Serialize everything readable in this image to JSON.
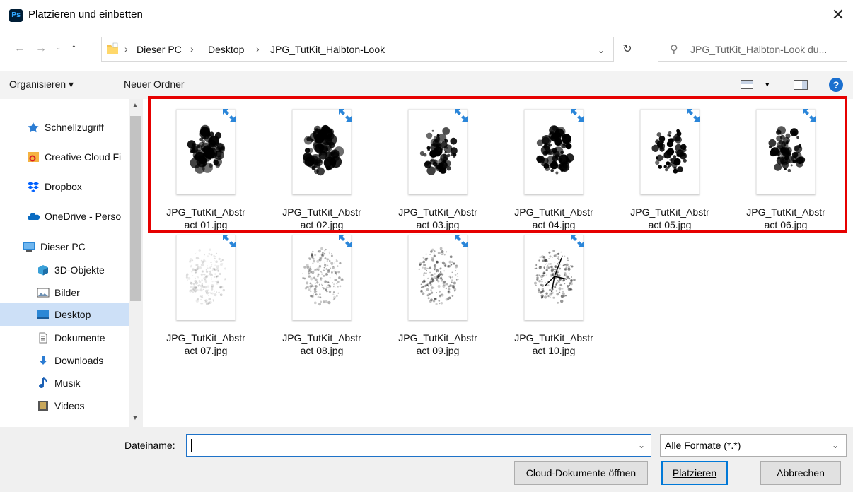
{
  "window": {
    "app_icon": "Ps",
    "title": "Platzieren und einbetten",
    "close_glyph": "✕"
  },
  "address": {
    "breadcrumbs": [
      "Dieser PC",
      "Desktop",
      "JPG_TutKit_Halbton-Look"
    ],
    "separator": "›",
    "search_placeholder": "JPG_TutKit_Halbton-Look du..."
  },
  "toolbar": {
    "organize_label": "Organisieren ▾",
    "new_folder_label": "Neuer Ordner",
    "help_glyph": "?"
  },
  "sidebar": {
    "items": [
      {
        "label": "Schnellzugriff",
        "icon": "star-icon",
        "color": "#2b7cd3"
      },
      {
        "label": "Creative Cloud Fi",
        "icon": "creative-cloud-icon",
        "color": "#f5b342"
      },
      {
        "label": "Dropbox",
        "icon": "dropbox-icon",
        "color": "#0061fe"
      },
      {
        "label": "OneDrive - Perso",
        "icon": "onedrive-icon",
        "color": "#0a6cc2"
      },
      {
        "label": "Dieser PC",
        "icon": "computer-icon",
        "color": "#2b87d6"
      },
      {
        "label": "3D-Objekte",
        "icon": "3d-objects-icon",
        "color": "#3aa0d8"
      },
      {
        "label": "Bilder",
        "icon": "pictures-icon",
        "color": "#6b8fb3"
      },
      {
        "label": "Desktop",
        "icon": "desktop-icon",
        "color": "#2b87d6"
      },
      {
        "label": "Dokumente",
        "icon": "documents-icon",
        "color": "#7a7a7a"
      },
      {
        "label": "Downloads",
        "icon": "downloads-icon",
        "color": "#2b7cd3"
      },
      {
        "label": "Musik",
        "icon": "music-icon",
        "color": "#1a5fb4"
      },
      {
        "label": "Videos",
        "icon": "videos-icon",
        "color": "#555555"
      }
    ],
    "selected": "Desktop"
  },
  "files": [
    {
      "line1": "JPG_TutKit_Abstr",
      "line2": "act 01.jpg"
    },
    {
      "line1": "JPG_TutKit_Abstr",
      "line2": "act 02.jpg"
    },
    {
      "line1": "JPG_TutKit_Abstr",
      "line2": "act 03.jpg"
    },
    {
      "line1": "JPG_TutKit_Abstr",
      "line2": "act 04.jpg"
    },
    {
      "line1": "JPG_TutKit_Abstr",
      "line2": "act 05.jpg"
    },
    {
      "line1": "JPG_TutKit_Abstr",
      "line2": "act 06.jpg"
    },
    {
      "line1": "JPG_TutKit_Abstr",
      "line2": "act 07.jpg"
    },
    {
      "line1": "JPG_TutKit_Abstr",
      "line2": "act 08.jpg"
    },
    {
      "line1": "JPG_TutKit_Abstr",
      "line2": "act 09.jpg"
    },
    {
      "line1": "JPG_TutKit_Abstr",
      "line2": "act 10.jpg"
    }
  ],
  "footer": {
    "filename_label_pre": "Datei",
    "filename_label_u": "n",
    "filename_label_post": "ame:",
    "filename_value": "",
    "filetype_value": "Alle Formate (*.*)",
    "cloud_button": "Cloud-Dokumente öffnen",
    "place_button": "Platzieren",
    "cancel_button": "Abbrechen"
  },
  "colors": {
    "highlight_border": "#e60000",
    "selection": "#cde0f7",
    "accent": "#0078d7"
  }
}
